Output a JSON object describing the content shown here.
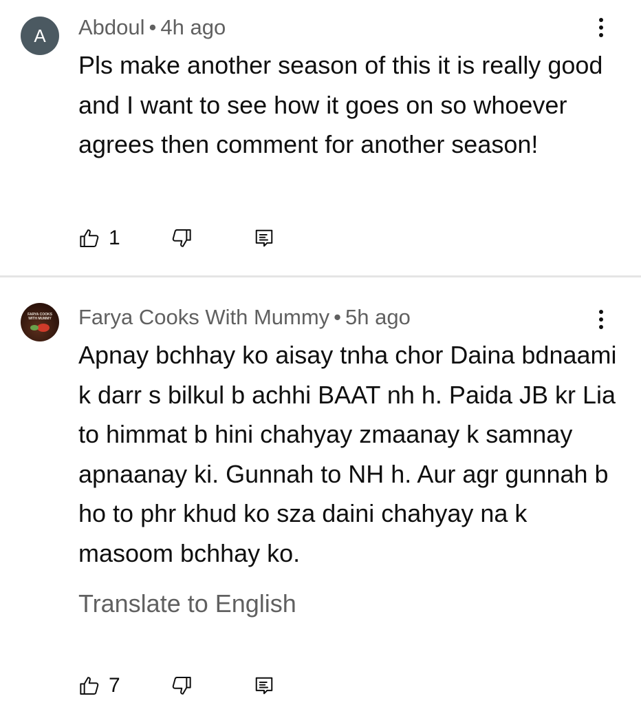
{
  "comments": [
    {
      "avatar_letter": "A",
      "author": "Abdoul",
      "separator": "•",
      "time": "4h ago",
      "text": "Pls make another season of this it is really good and I want to see how it goes on so whoever agrees then comment for another season!",
      "likes": "1",
      "icons": {
        "like": "thumb-up-icon",
        "dislike": "thumb-down-icon",
        "reply": "reply-icon",
        "more": "more-vert-icon"
      }
    },
    {
      "avatar_text": "FARYA COOKS WITH MUMMY",
      "author": "Farya Cooks With Mummy",
      "separator": "•",
      "time": "5h ago",
      "text": "Apnay bchhay ko aisay tnha chor Daina bdnaami k darr s bilkul b achhi BAAT nh h. Paida JB kr Lia to himmat b hini chahyay zmaanay k samnay apnaanay ki. Gunnah to NH h. Aur agr gunnah b ho to phr khud ko sza daini chahyay na k masoom bchhay ko.",
      "translate_label": "Translate to English",
      "likes": "7",
      "icons": {
        "like": "thumb-up-icon",
        "dislike": "thumb-down-icon",
        "reply": "reply-icon",
        "more": "more-vert-icon"
      }
    }
  ],
  "colors": {
    "primary_text": "#0f0f0f",
    "secondary_text": "#606060",
    "divider": "#e5e5e5",
    "avatar_bg": "#4b5961"
  }
}
